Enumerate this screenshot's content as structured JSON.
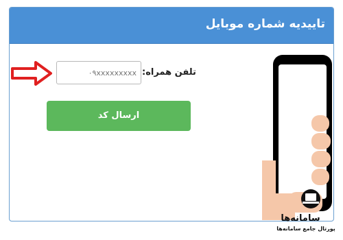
{
  "card": {
    "title": "تاییدیه شماره موبایل"
  },
  "form": {
    "phone_label": "تلفن همراه:",
    "phone_placeholder": "۰۹xxxxxxxxx",
    "send_label": "ارسال کد"
  },
  "watermark": {
    "name": "سامانه‌ها",
    "subtitle": "پورتال جامع سامانه‌ها"
  },
  "colors": {
    "header": "#4a90d6",
    "button": "#5cb85c",
    "arrow": "#e02020",
    "phone_body": "#000000",
    "hand": "#f5c7a9"
  },
  "icons": {
    "arrow": "arrow-right-icon",
    "phone": "smartphone-icon",
    "logo": "laptop-logo-icon"
  }
}
